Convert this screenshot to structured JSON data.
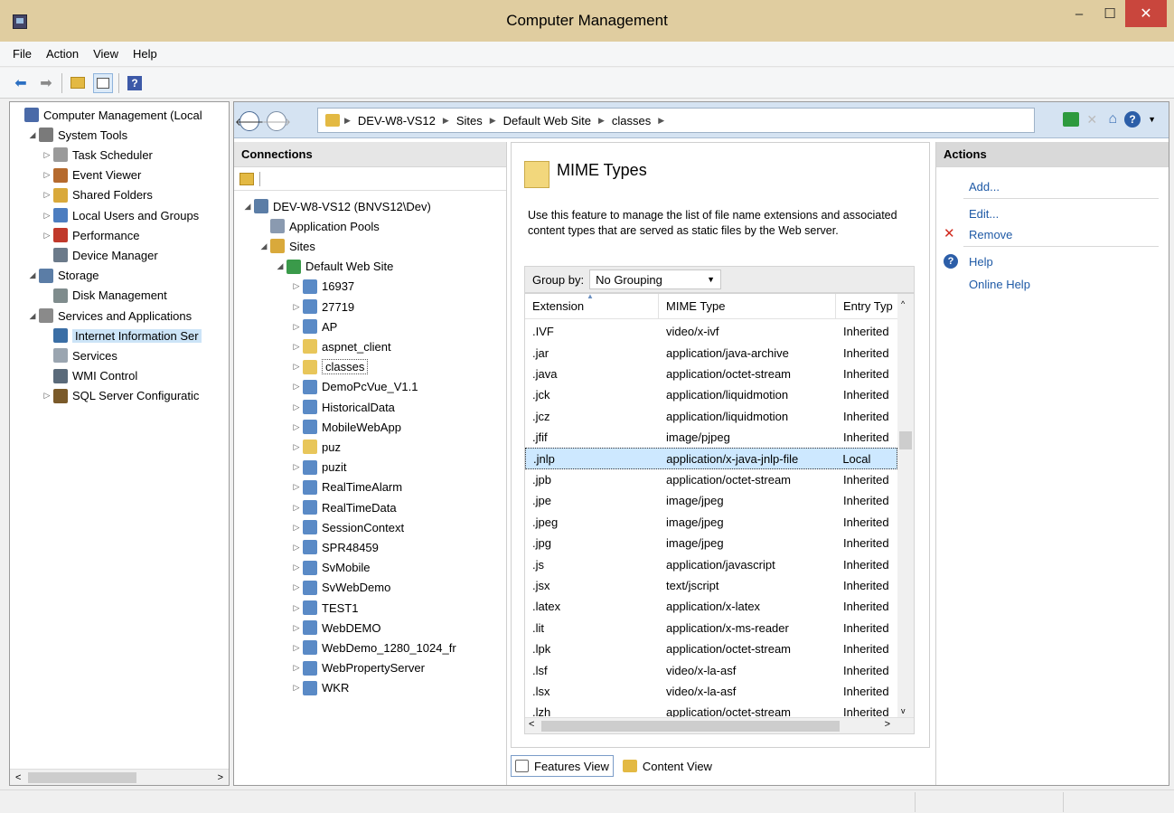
{
  "window": {
    "title": "Computer Management",
    "minimize": "–",
    "maximize": "☐",
    "close": "✕"
  },
  "menu": [
    "File",
    "Action",
    "View",
    "Help"
  ],
  "left_tree": [
    {
      "label": "Computer Management (Local",
      "indent": 0,
      "arrow": "",
      "icon": "computer-icon",
      "color": "#4a6aa8"
    },
    {
      "label": "System Tools",
      "indent": 1,
      "arrow": "◢",
      "icon": "tools-icon",
      "color": "#7a7a7a"
    },
    {
      "label": "Task Scheduler",
      "indent": 2,
      "arrow": "▷",
      "icon": "clock-icon",
      "color": "#9a9a9a"
    },
    {
      "label": "Event Viewer",
      "indent": 2,
      "arrow": "▷",
      "icon": "event-viewer-icon",
      "color": "#b56a2e"
    },
    {
      "label": "Shared Folders",
      "indent": 2,
      "arrow": "▷",
      "icon": "shared-folder-icon",
      "color": "#d9a93b"
    },
    {
      "label": "Local Users and Groups",
      "indent": 2,
      "arrow": "▷",
      "icon": "users-icon",
      "color": "#4c7dc0"
    },
    {
      "label": "Performance",
      "indent": 2,
      "arrow": "▷",
      "icon": "performance-icon",
      "color": "#c0392b"
    },
    {
      "label": "Device Manager",
      "indent": 2,
      "arrow": "",
      "icon": "device-manager-icon",
      "color": "#6b7a8a"
    },
    {
      "label": "Storage",
      "indent": 1,
      "arrow": "◢",
      "icon": "storage-icon",
      "color": "#5b7da6"
    },
    {
      "label": "Disk Management",
      "indent": 2,
      "arrow": "",
      "icon": "disk-icon",
      "color": "#7f8c8d"
    },
    {
      "label": "Services and Applications",
      "indent": 1,
      "arrow": "◢",
      "icon": "services-apps-icon",
      "color": "#8a8a8a"
    },
    {
      "label": "Internet Information Ser",
      "indent": 2,
      "arrow": "",
      "icon": "iis-icon",
      "color": "#3a6ea5",
      "selected": true
    },
    {
      "label": "Services",
      "indent": 2,
      "arrow": "",
      "icon": "services-icon",
      "color": "#9aa5b0"
    },
    {
      "label": "WMI Control",
      "indent": 2,
      "arrow": "",
      "icon": "wmi-icon",
      "color": "#5a6a7a"
    },
    {
      "label": "SQL Server Configuratic",
      "indent": 2,
      "arrow": "▷",
      "icon": "sql-server-icon",
      "color": "#7a5a2a"
    }
  ],
  "address": {
    "crumbs": [
      "DEV-W8-VS12",
      "Sites",
      "Default Web Site",
      "classes"
    ]
  },
  "connections": {
    "title": "Connections",
    "items": [
      {
        "label": "DEV-W8-VS12 (BNVS12\\Dev)",
        "indent": 0,
        "arrow": "◢",
        "icon": "server-icon",
        "color": "#5b7da6"
      },
      {
        "label": "Application Pools",
        "indent": 1,
        "arrow": "",
        "icon": "app-pools-icon",
        "color": "#8a9ab0"
      },
      {
        "label": "Sites",
        "indent": 1,
        "arrow": "◢",
        "icon": "sites-icon",
        "color": "#d9a93b"
      },
      {
        "label": "Default Web Site",
        "indent": 2,
        "arrow": "◢",
        "icon": "globe-icon",
        "color": "#3a9a4a"
      },
      {
        "label": "16937",
        "indent": 3,
        "arrow": "▷",
        "icon": "app-icon",
        "color": "#5a8ac6"
      },
      {
        "label": "27719",
        "indent": 3,
        "arrow": "▷",
        "icon": "app-icon",
        "color": "#5a8ac6"
      },
      {
        "label": "AP",
        "indent": 3,
        "arrow": "▷",
        "icon": "app-icon",
        "color": "#5a8ac6"
      },
      {
        "label": "aspnet_client",
        "indent": 3,
        "arrow": "▷",
        "icon": "folder-icon",
        "color": "#e8c65a"
      },
      {
        "label": "classes",
        "indent": 3,
        "arrow": "▷",
        "icon": "virtual-dir-icon",
        "color": "#e8c65a",
        "selected": true
      },
      {
        "label": "DemoPcVue_V1.1",
        "indent": 3,
        "arrow": "▷",
        "icon": "app-icon",
        "color": "#5a8ac6"
      },
      {
        "label": "HistoricalData",
        "indent": 3,
        "arrow": "▷",
        "icon": "app-icon",
        "color": "#5a8ac6"
      },
      {
        "label": "MobileWebApp",
        "indent": 3,
        "arrow": "▷",
        "icon": "app-icon",
        "color": "#5a8ac6"
      },
      {
        "label": "puz",
        "indent": 3,
        "arrow": "▷",
        "icon": "virtual-dir-icon",
        "color": "#e8c65a"
      },
      {
        "label": "puzit",
        "indent": 3,
        "arrow": "▷",
        "icon": "app-icon",
        "color": "#5a8ac6"
      },
      {
        "label": "RealTimeAlarm",
        "indent": 3,
        "arrow": "▷",
        "icon": "app-icon",
        "color": "#5a8ac6"
      },
      {
        "label": "RealTimeData",
        "indent": 3,
        "arrow": "▷",
        "icon": "app-icon",
        "color": "#5a8ac6"
      },
      {
        "label": "SessionContext",
        "indent": 3,
        "arrow": "▷",
        "icon": "app-icon",
        "color": "#5a8ac6"
      },
      {
        "label": "SPR48459",
        "indent": 3,
        "arrow": "▷",
        "icon": "app-icon",
        "color": "#5a8ac6"
      },
      {
        "label": "SvMobile",
        "indent": 3,
        "arrow": "▷",
        "icon": "app-icon",
        "color": "#5a8ac6"
      },
      {
        "label": "SvWebDemo",
        "indent": 3,
        "arrow": "▷",
        "icon": "app-icon",
        "color": "#5a8ac6"
      },
      {
        "label": "TEST1",
        "indent": 3,
        "arrow": "▷",
        "icon": "app-icon",
        "color": "#5a8ac6"
      },
      {
        "label": "WebDEMO",
        "indent": 3,
        "arrow": "▷",
        "icon": "app-icon",
        "color": "#5a8ac6"
      },
      {
        "label": "WebDemo_1280_1024_fr",
        "indent": 3,
        "arrow": "▷",
        "icon": "app-icon",
        "color": "#5a8ac6"
      },
      {
        "label": "WebPropertyServer",
        "indent": 3,
        "arrow": "▷",
        "icon": "app-icon",
        "color": "#5a8ac6"
      },
      {
        "label": "WKR",
        "indent": 3,
        "arrow": "▷",
        "icon": "app-icon",
        "color": "#5a8ac6"
      }
    ]
  },
  "feature": {
    "title": "MIME Types",
    "description": "Use this feature to manage the list of file name extensions and associated content types that are served as static files by the Web server.",
    "group_by_label": "Group by:",
    "group_by_value": "No Grouping",
    "columns": [
      "Extension",
      "MIME Type",
      "Entry Typ"
    ],
    "rows": [
      [
        ".IVF",
        "video/x-ivf",
        "Inherited"
      ],
      [
        ".jar",
        "application/java-archive",
        "Inherited"
      ],
      [
        ".java",
        "application/octet-stream",
        "Inherited"
      ],
      [
        ".jck",
        "application/liquidmotion",
        "Inherited"
      ],
      [
        ".jcz",
        "application/liquidmotion",
        "Inherited"
      ],
      [
        ".jfif",
        "image/pjpeg",
        "Inherited"
      ],
      [
        ".jnlp",
        "application/x-java-jnlp-file",
        "Local"
      ],
      [
        ".jpb",
        "application/octet-stream",
        "Inherited"
      ],
      [
        ".jpe",
        "image/jpeg",
        "Inherited"
      ],
      [
        ".jpeg",
        "image/jpeg",
        "Inherited"
      ],
      [
        ".jpg",
        "image/jpeg",
        "Inherited"
      ],
      [
        ".js",
        "application/javascript",
        "Inherited"
      ],
      [
        ".jsx",
        "text/jscript",
        "Inherited"
      ],
      [
        ".latex",
        "application/x-latex",
        "Inherited"
      ],
      [
        ".lit",
        "application/x-ms-reader",
        "Inherited"
      ],
      [
        ".lpk",
        "application/octet-stream",
        "Inherited"
      ],
      [
        ".lsf",
        "video/x-la-asf",
        "Inherited"
      ],
      [
        ".lsx",
        "video/x-la-asf",
        "Inherited"
      ],
      [
        ".lzh",
        "application/octet-stream",
        "Inherited"
      ]
    ],
    "selected_row": 6,
    "features_view": "Features View",
    "content_view": "Content View"
  },
  "actions": {
    "title": "Actions",
    "add": "Add...",
    "edit": "Edit...",
    "remove": "Remove",
    "help": "Help",
    "online_help": "Online Help"
  }
}
